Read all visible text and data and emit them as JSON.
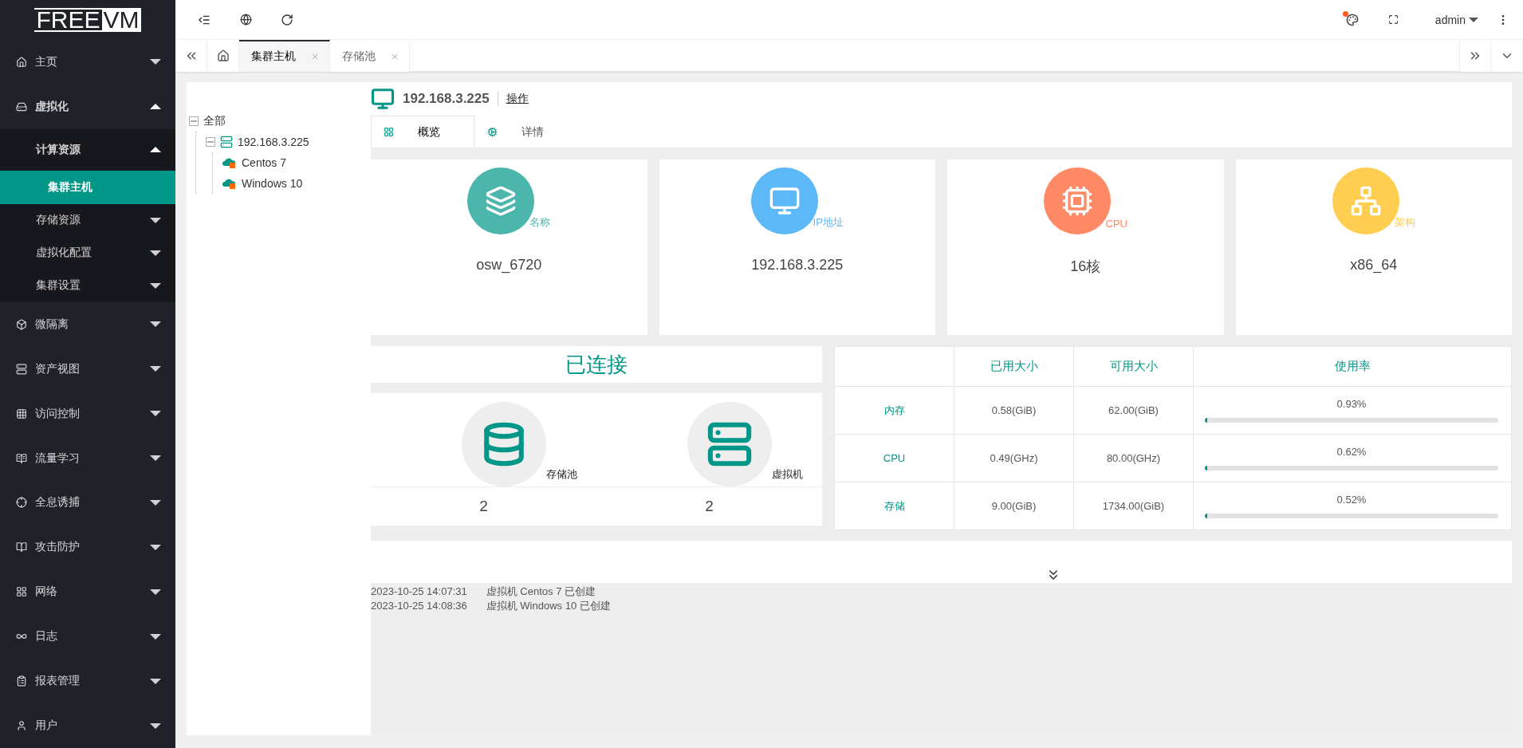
{
  "logo": {
    "left": "FREE",
    "right": "VM"
  },
  "sidebar": {
    "items": [
      {
        "label": "主页",
        "expanded": false,
        "selected": false
      },
      {
        "label": "虚拟化",
        "expanded": true,
        "selected": false,
        "children": [
          {
            "label": "计算资源",
            "expanded": true,
            "selected": false,
            "children": [
              {
                "label": "集群主机",
                "selected": true
              }
            ]
          },
          {
            "label": "存储资源",
            "expanded": false,
            "selected": false
          },
          {
            "label": "虚拟化配置",
            "expanded": false,
            "selected": false
          },
          {
            "label": "集群设置",
            "expanded": false,
            "selected": false
          }
        ]
      },
      {
        "label": "微隔离",
        "expanded": false,
        "selected": false
      },
      {
        "label": "资产视图",
        "expanded": false,
        "selected": false
      },
      {
        "label": "访问控制",
        "expanded": false,
        "selected": false
      },
      {
        "label": "流量学习",
        "expanded": false,
        "selected": false
      },
      {
        "label": "全息诱捕",
        "expanded": false,
        "selected": false
      },
      {
        "label": "攻击防护",
        "expanded": false,
        "selected": false
      },
      {
        "label": "网络",
        "expanded": false,
        "selected": false
      },
      {
        "label": "日志",
        "expanded": false,
        "selected": false
      },
      {
        "label": "报表管理",
        "expanded": false,
        "selected": false
      },
      {
        "label": "用户",
        "expanded": false,
        "selected": false
      }
    ]
  },
  "topbar": {
    "user": "admin",
    "notification": true
  },
  "page_tabs": [
    {
      "label": "集群主机",
      "selected": true
    },
    {
      "label": "存储池",
      "selected": false
    }
  ],
  "tree": {
    "label": "全部",
    "expanded": true,
    "children": [
      {
        "label": "192.168.3.225",
        "kind": "host",
        "expanded": true,
        "children": [
          {
            "label": "Centos 7",
            "kind": "vm"
          },
          {
            "label": "Windows 10",
            "kind": "vm"
          }
        ]
      }
    ]
  },
  "header": {
    "title": "192.168.3.225",
    "action": "操作"
  },
  "detail_tabs": [
    {
      "label": "概览",
      "selected": true
    },
    {
      "label": "详情",
      "selected": false
    }
  ],
  "cards": [
    {
      "kind": "name",
      "label": "名称",
      "value": "osw_6720",
      "color": "#4db6ac"
    },
    {
      "kind": "ip",
      "label": "IP地址",
      "value": "192.168.3.225",
      "color": "#5cb8f7"
    },
    {
      "kind": "cpu",
      "label": "CPU",
      "value": "16核",
      "color": "#ff8a65"
    },
    {
      "kind": "arch",
      "label": "架构",
      "value": "x86_64",
      "color": "#ffcd4f"
    }
  ],
  "status": "已连接",
  "counters": [
    {
      "kind": "storage",
      "label": "存储池",
      "value": "2"
    },
    {
      "kind": "vm",
      "label": "虚拟机",
      "value": "2"
    }
  ],
  "usage_table": {
    "columns": [
      "已用大小",
      "可用大小",
      "使用率"
    ],
    "rows": [
      {
        "name": "内存",
        "used": "0.58(GiB)",
        "free": "62.00(GiB)",
        "rate": "0.93%",
        "level": 0.0093
      },
      {
        "name": "CPU",
        "used": "0.49(GHz)",
        "free": "80.00(GHz)",
        "rate": "0.62%",
        "level": 0.0062
      },
      {
        "name": "存储",
        "used": "9.00(GiB)",
        "free": "1734.00(GiB)",
        "rate": "0.52%",
        "level": 0.0052
      }
    ]
  },
  "events": [
    {
      "time": "2023-10-25 14:07:31",
      "text": "虚拟机 Centos 7 已创建"
    },
    {
      "time": "2023-10-25 14:08:36",
      "text": "虚拟机 Windows 10 已创建"
    }
  ]
}
